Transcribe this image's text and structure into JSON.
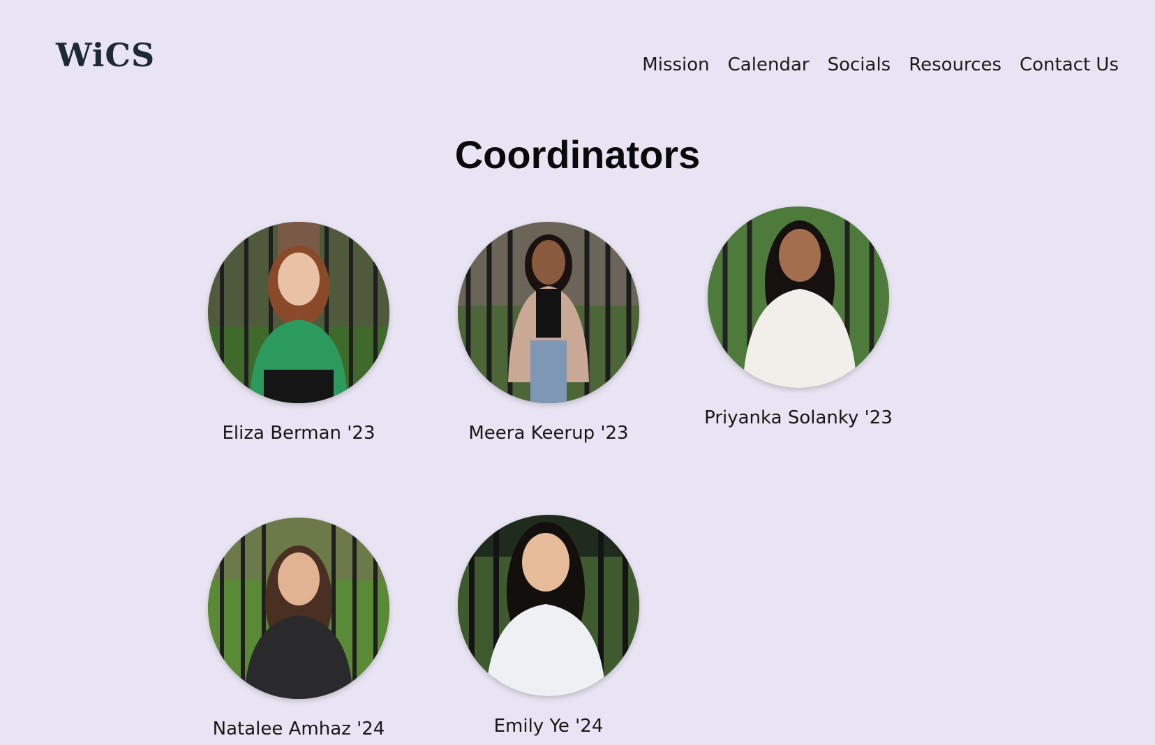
{
  "header": {
    "logo": "WiCS",
    "nav": [
      "Mission",
      "Calendar",
      "Socials",
      "Resources",
      "Contact Us"
    ]
  },
  "main": {
    "title": "Coordinators",
    "people": [
      {
        "name": "Eliza Berman '23",
        "shirt": "#2b9a5c",
        "hair": "#8a4a2a"
      },
      {
        "name": "Meera Keerup '23",
        "shirt": "#c9a896",
        "hair": "#1a1210"
      },
      {
        "name": "Priyanka Solanky '23",
        "shirt": "#f2eeea",
        "hair": "#16110f"
      },
      {
        "name": "Natalee Amhaz '24",
        "shirt": "#2a2a2c",
        "hair": "#4a3022"
      },
      {
        "name": "Emily Ye '24",
        "shirt": "#eef0f4",
        "hair": "#120f0d"
      }
    ]
  },
  "colors": {
    "background": "#e9e4f3",
    "text": "#161a1f"
  }
}
